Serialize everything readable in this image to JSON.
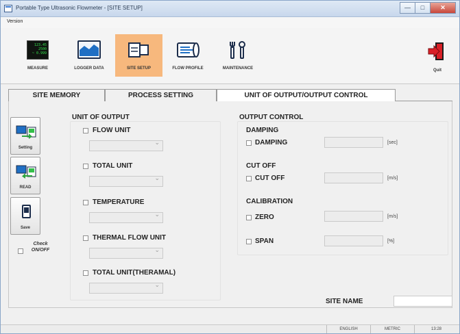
{
  "window": {
    "title": "Portable Type Ultrasonic Flowmeter - [SITE SETUP]",
    "controls": {
      "minimize": "—",
      "maximize": "□",
      "close": "✕"
    }
  },
  "menu": {
    "version": "Version"
  },
  "toolbar": {
    "measure": {
      "label": "MEASURE",
      "display_lines": [
        "123.45",
        "2500",
        "~ 0.999"
      ]
    },
    "logger_data": {
      "label": "LOGGER DATA"
    },
    "site_setup": {
      "label": "SITE SETUP",
      "active": true
    },
    "flow_profile": {
      "label": "FLOW PROFILE"
    },
    "maintenance": {
      "label": "MAINTENANCE"
    },
    "quit": {
      "label": "Quit"
    }
  },
  "tabs": [
    {
      "label": "SITE MEMORY",
      "active": false
    },
    {
      "label": "PROCESS SETTING",
      "active": false
    },
    {
      "label": "UNIT OF OUTPUT/OUTPUT CONTROL",
      "active": true
    }
  ],
  "side": {
    "setting": "Setting",
    "read": "READ",
    "save": "Save",
    "check_onoff": "Check ON/OFF"
  },
  "unit_of_output": {
    "title": "UNIT OF OUTPUT",
    "items": [
      {
        "label": "FLOW UNIT",
        "checked": false,
        "value": ""
      },
      {
        "label": "TOTAL UNIT",
        "checked": false,
        "value": ""
      },
      {
        "label": "TEMPERATURE",
        "checked": false,
        "value": ""
      },
      {
        "label": "THERMAL FLOW UNIT",
        "checked": false,
        "value": ""
      },
      {
        "label": "TOTAL UNIT(THERAMAL)",
        "checked": false,
        "value": ""
      }
    ]
  },
  "output_control": {
    "title": "OUTPUT CONTROL",
    "damping": {
      "title": "DAMPING",
      "label": "DAMPING",
      "unit": "[sec]",
      "value": ""
    },
    "cutoff": {
      "title": "CUT OFF",
      "label": "CUT OFF",
      "unit": "[m/s]",
      "value": ""
    },
    "calibration": {
      "title": "CALIBRATION",
      "zero": {
        "label": "ZERO",
        "unit": "[m/s]",
        "value": ""
      },
      "span": {
        "label": "SPAN",
        "unit": "[%]",
        "value": ""
      }
    }
  },
  "site_name": {
    "label": "SITE NAME",
    "value": ""
  },
  "status": {
    "language": "ENGLISH",
    "units": "METRIC",
    "time": "13:28"
  },
  "colors": {
    "active_tool": "#f7b87d",
    "quit_red": "#d92027",
    "accent_blue": "#1f6fc4"
  }
}
